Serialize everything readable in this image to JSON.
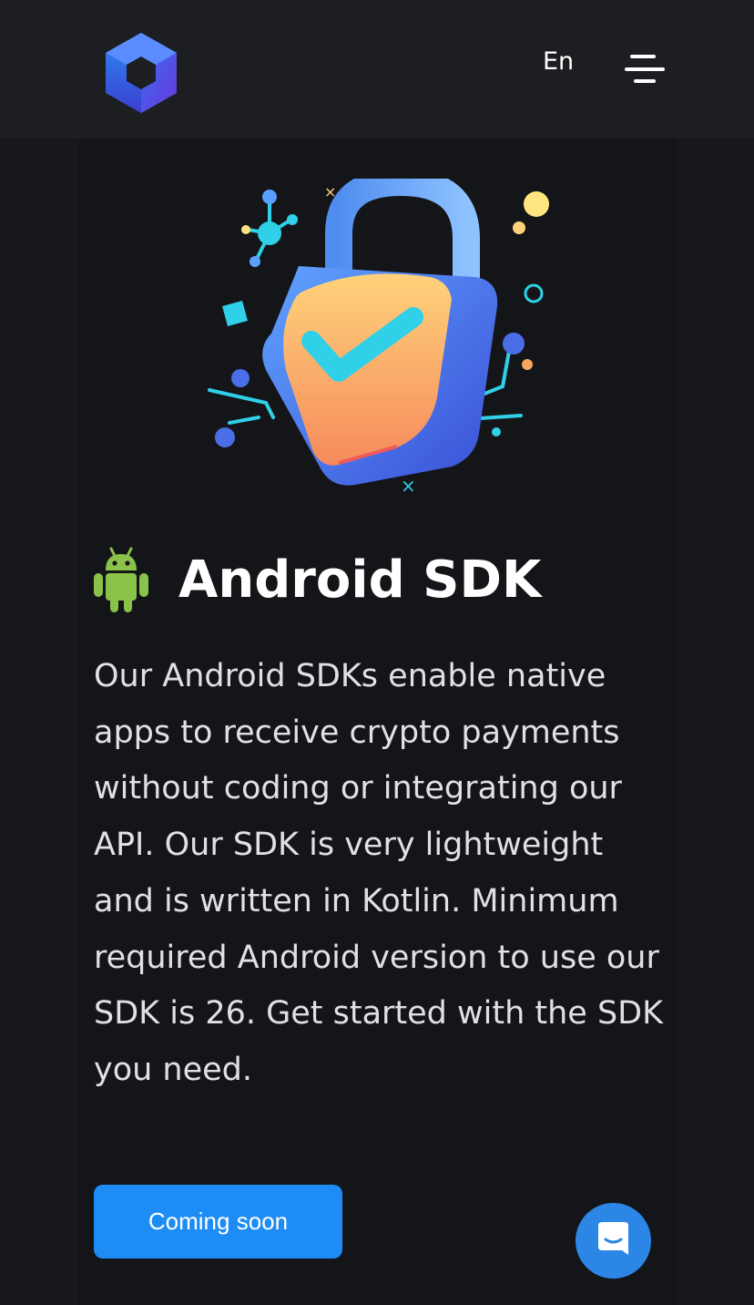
{
  "header": {
    "logo_icon": "hexagon-cube-logo",
    "language_label": "En",
    "menu_icon": "hamburger-menu-icon"
  },
  "hero": {
    "illustration": "security-lock-shield-checkmark",
    "colors": {
      "lock": "#5b8def",
      "shield": "#f7a75d",
      "check": "#2fd0e8"
    }
  },
  "section": {
    "icon": "android-icon",
    "title": "Android SDK",
    "description": "Our Android SDKs enable native apps to receive crypto payments without coding or integrating our API. Our SDK is very lightweight and is written in Kotlin. Minimum required Android version to use our SDK is 26. Get started with the SDK you need.",
    "button_label": "Coming soon"
  },
  "chat_widget": {
    "icon": "chat-bubble-icon"
  },
  "colors": {
    "accent": "#1e8cf5",
    "android_green": "#8bc34a",
    "background": "#17181b"
  }
}
